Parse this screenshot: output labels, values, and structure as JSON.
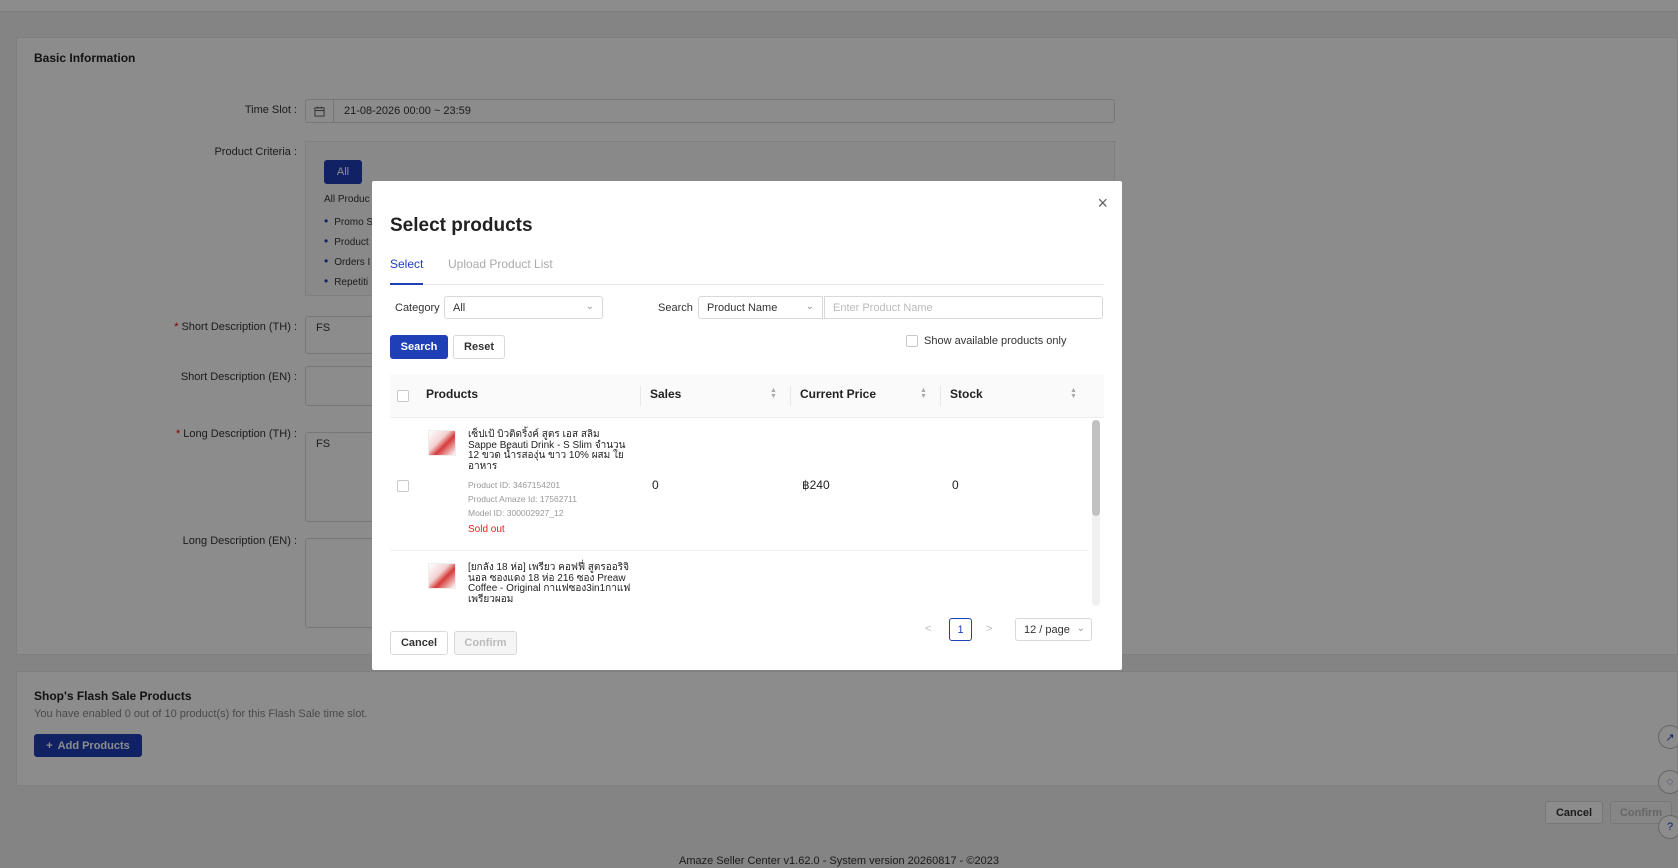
{
  "page": {
    "basic_info_title": "Basic Information",
    "time_slot_label": "Time Slot :",
    "time_slot_value": "21-08-2026 00:00 ~ 23:59",
    "product_criteria_label": "Product Criteria :",
    "criteria_all_button": "All",
    "criteria_desc": "All Produc",
    "criteria_items": [
      "Promo S",
      "Product",
      "Orders I",
      "Repetiti"
    ],
    "short_desc_th_label": "Short Description (TH) :",
    "short_desc_th_value": "FS",
    "short_desc_en_label": "Short Description (EN) :",
    "long_desc_th_label": "Long Description (TH) :",
    "long_desc_th_value": "FS",
    "long_desc_en_label": "Long Description (EN) :",
    "flash_title": "Shop's Flash Sale Products",
    "flash_subtitle": "You have enabled 0 out of 10 product(s) for this Flash Sale time slot.",
    "add_products_label": "Add Products",
    "cancel_label": "Cancel",
    "confirm_label": "Confirm",
    "footer": "Amaze Seller Center v1.62.0 - System version 20260817 - ©2023"
  },
  "modal": {
    "title": "Select products",
    "tabs": [
      {
        "label": "Select",
        "active": true
      },
      {
        "label": "Upload Product List",
        "active": false
      }
    ],
    "category_label": "Category",
    "category_value": "All",
    "search_label": "Search",
    "search_field_value": "Product Name",
    "search_placeholder": "Enter Product Name",
    "search_button": "Search",
    "reset_button": "Reset",
    "available_only_label": "Show available products only",
    "columns": [
      "Products",
      "Sales",
      "Current Price",
      "Stock"
    ],
    "rows": [
      {
        "name": "เซ็ปเป้ บิวติดริ้งค์ สูตร เอส สลิม Sappe Beauti Drink - S Slim จำนวน 12 ขวด น้ำรสองุ่น ขาว 10% ผสม ใยอาหาร",
        "product_id": "Product ID: 3467154201",
        "amaze_id": "Product Amaze Id: 17562711",
        "model_id": "Model ID: 300002927_12",
        "status": "Sold out",
        "sales": "0",
        "price": "฿240",
        "stock": "0"
      },
      {
        "name": "[ยกลัง 18 ห่อ] เพรียว คอฟฟี่ สูตรออริจินอล ซองแดง 18 ห่อ 216 ซอง Preaw Coffee - Original กาแฟซอง3in1กาแฟเพรียวผอม"
      }
    ],
    "pagination": {
      "current_page": "1",
      "page_size": "12 / page",
      "prev": "<",
      "next": ">"
    },
    "cancel_label": "Cancel",
    "confirm_label": "Confirm",
    "close_icon": "close-icon"
  },
  "colors": {
    "primary": "#1f3fb7",
    "danger": "#e02020"
  }
}
